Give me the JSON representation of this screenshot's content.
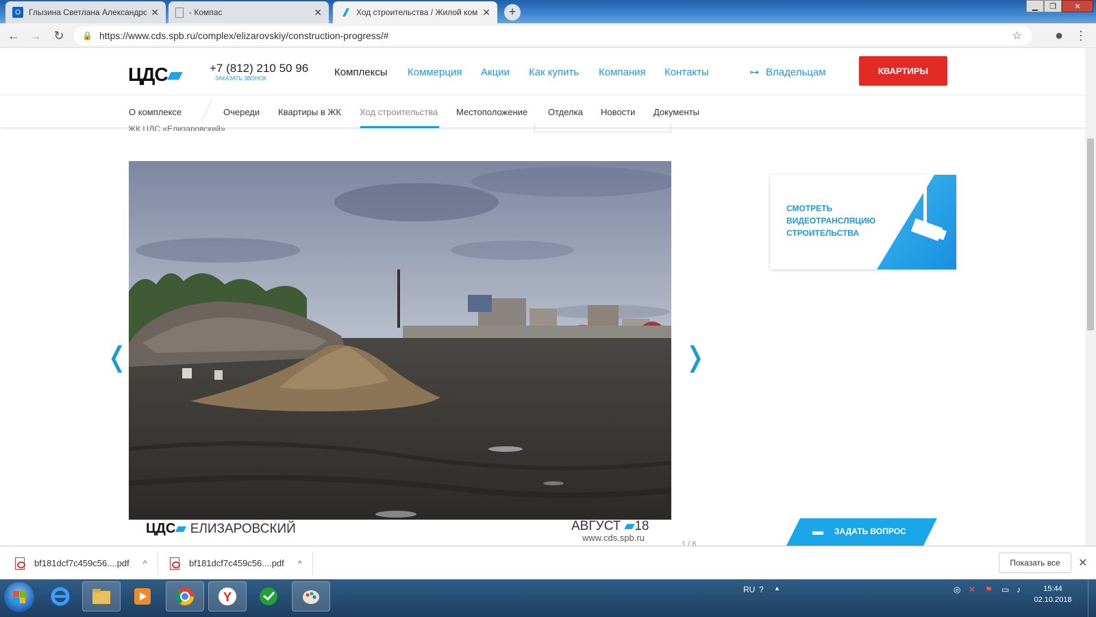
{
  "browser": {
    "tabs": [
      {
        "label": "Глызина Светлана Александров",
        "icon": "outlook-icon",
        "active": false
      },
      {
        "label": "- Компас",
        "icon": "document-icon",
        "active": false
      },
      {
        "label": "Ход строительства / Жилой ком",
        "icon": "cds-favicon",
        "active": true
      }
    ],
    "new_tab": "+",
    "url": "https://www.cds.spb.ru/complex/elizarovskiy/construction-progress/#"
  },
  "site": {
    "logo": "ЦДС",
    "phone": "+7 (812) 210 50 96",
    "callback": "ЗАКАЗАТЬ ЗВОНОК",
    "menu": [
      "Комплексы",
      "Коммерция",
      "Акции",
      "Как купить",
      "Компания",
      "Контакты"
    ],
    "owners": "Владельцам",
    "apartments_button": "КВАРТИРЫ",
    "subnav": [
      "О комплексе",
      "Очереди",
      "Квартиры в ЖК",
      "Ход строительства",
      "Местоположение",
      "Отделка",
      "Новости",
      "Документы"
    ],
    "breadcrumb": "ЖК ЦДС «Елизаровский»",
    "gallery": {
      "caption_logo": "ЦДС",
      "caption_name": "ЕЛИЗАРОВСКИЙ",
      "caption_month": "АВГУСТ",
      "caption_year": "18",
      "caption_url": "www.cds.spb.ru",
      "counter": "1 / 6",
      "prev": "❬",
      "next": "❭"
    },
    "video_card": "СМОТРЕТЬ ВИДЕОТРАНСЛЯЦИЮ СТРОИТЕЛЬСТВА",
    "ask_button": "ЗАДАТЬ ВОПРОС"
  },
  "downloads": {
    "items": [
      "bf181dcf7c459c56....pdf",
      "bf181dcf7c459c56....pdf"
    ],
    "show_all": "Показать все"
  },
  "taskbar": {
    "lang": "RU",
    "time": "15:44",
    "date": "02.10.2018"
  },
  "colors": {
    "accent": "#1a9bd8",
    "button_red": "#e32b25"
  }
}
